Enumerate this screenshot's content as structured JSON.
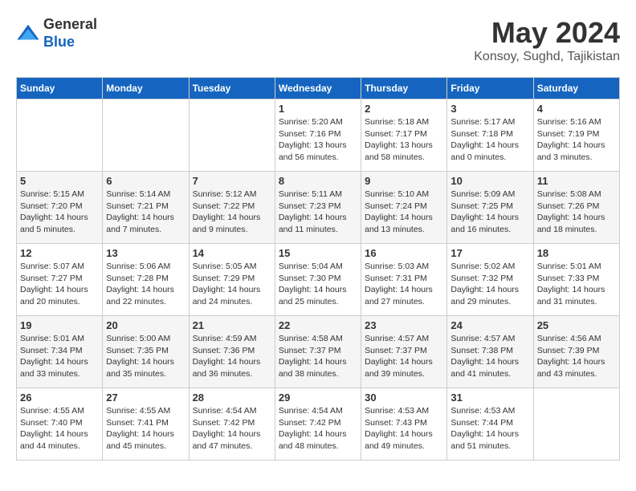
{
  "logo": {
    "line1": "General",
    "line2": "Blue"
  },
  "title": "May 2024",
  "subtitle": "Konsoy, Sughd, Tajikistan",
  "weekdays": [
    "Sunday",
    "Monday",
    "Tuesday",
    "Wednesday",
    "Thursday",
    "Friday",
    "Saturday"
  ],
  "weeks": [
    [
      {
        "day": "",
        "sunrise": "",
        "sunset": "",
        "daylight": ""
      },
      {
        "day": "",
        "sunrise": "",
        "sunset": "",
        "daylight": ""
      },
      {
        "day": "",
        "sunrise": "",
        "sunset": "",
        "daylight": ""
      },
      {
        "day": "1",
        "sunrise": "Sunrise: 5:20 AM",
        "sunset": "Sunset: 7:16 PM",
        "daylight": "Daylight: 13 hours and 56 minutes."
      },
      {
        "day": "2",
        "sunrise": "Sunrise: 5:18 AM",
        "sunset": "Sunset: 7:17 PM",
        "daylight": "Daylight: 13 hours and 58 minutes."
      },
      {
        "day": "3",
        "sunrise": "Sunrise: 5:17 AM",
        "sunset": "Sunset: 7:18 PM",
        "daylight": "Daylight: 14 hours and 0 minutes."
      },
      {
        "day": "4",
        "sunrise": "Sunrise: 5:16 AM",
        "sunset": "Sunset: 7:19 PM",
        "daylight": "Daylight: 14 hours and 3 minutes."
      }
    ],
    [
      {
        "day": "5",
        "sunrise": "Sunrise: 5:15 AM",
        "sunset": "Sunset: 7:20 PM",
        "daylight": "Daylight: 14 hours and 5 minutes."
      },
      {
        "day": "6",
        "sunrise": "Sunrise: 5:14 AM",
        "sunset": "Sunset: 7:21 PM",
        "daylight": "Daylight: 14 hours and 7 minutes."
      },
      {
        "day": "7",
        "sunrise": "Sunrise: 5:12 AM",
        "sunset": "Sunset: 7:22 PM",
        "daylight": "Daylight: 14 hours and 9 minutes."
      },
      {
        "day": "8",
        "sunrise": "Sunrise: 5:11 AM",
        "sunset": "Sunset: 7:23 PM",
        "daylight": "Daylight: 14 hours and 11 minutes."
      },
      {
        "day": "9",
        "sunrise": "Sunrise: 5:10 AM",
        "sunset": "Sunset: 7:24 PM",
        "daylight": "Daylight: 14 hours and 13 minutes."
      },
      {
        "day": "10",
        "sunrise": "Sunrise: 5:09 AM",
        "sunset": "Sunset: 7:25 PM",
        "daylight": "Daylight: 14 hours and 16 minutes."
      },
      {
        "day": "11",
        "sunrise": "Sunrise: 5:08 AM",
        "sunset": "Sunset: 7:26 PM",
        "daylight": "Daylight: 14 hours and 18 minutes."
      }
    ],
    [
      {
        "day": "12",
        "sunrise": "Sunrise: 5:07 AM",
        "sunset": "Sunset: 7:27 PM",
        "daylight": "Daylight: 14 hours and 20 minutes."
      },
      {
        "day": "13",
        "sunrise": "Sunrise: 5:06 AM",
        "sunset": "Sunset: 7:28 PM",
        "daylight": "Daylight: 14 hours and 22 minutes."
      },
      {
        "day": "14",
        "sunrise": "Sunrise: 5:05 AM",
        "sunset": "Sunset: 7:29 PM",
        "daylight": "Daylight: 14 hours and 24 minutes."
      },
      {
        "day": "15",
        "sunrise": "Sunrise: 5:04 AM",
        "sunset": "Sunset: 7:30 PM",
        "daylight": "Daylight: 14 hours and 25 minutes."
      },
      {
        "day": "16",
        "sunrise": "Sunrise: 5:03 AM",
        "sunset": "Sunset: 7:31 PM",
        "daylight": "Daylight: 14 hours and 27 minutes."
      },
      {
        "day": "17",
        "sunrise": "Sunrise: 5:02 AM",
        "sunset": "Sunset: 7:32 PM",
        "daylight": "Daylight: 14 hours and 29 minutes."
      },
      {
        "day": "18",
        "sunrise": "Sunrise: 5:01 AM",
        "sunset": "Sunset: 7:33 PM",
        "daylight": "Daylight: 14 hours and 31 minutes."
      }
    ],
    [
      {
        "day": "19",
        "sunrise": "Sunrise: 5:01 AM",
        "sunset": "Sunset: 7:34 PM",
        "daylight": "Daylight: 14 hours and 33 minutes."
      },
      {
        "day": "20",
        "sunrise": "Sunrise: 5:00 AM",
        "sunset": "Sunset: 7:35 PM",
        "daylight": "Daylight: 14 hours and 35 minutes."
      },
      {
        "day": "21",
        "sunrise": "Sunrise: 4:59 AM",
        "sunset": "Sunset: 7:36 PM",
        "daylight": "Daylight: 14 hours and 36 minutes."
      },
      {
        "day": "22",
        "sunrise": "Sunrise: 4:58 AM",
        "sunset": "Sunset: 7:37 PM",
        "daylight": "Daylight: 14 hours and 38 minutes."
      },
      {
        "day": "23",
        "sunrise": "Sunrise: 4:57 AM",
        "sunset": "Sunset: 7:37 PM",
        "daylight": "Daylight: 14 hours and 39 minutes."
      },
      {
        "day": "24",
        "sunrise": "Sunrise: 4:57 AM",
        "sunset": "Sunset: 7:38 PM",
        "daylight": "Daylight: 14 hours and 41 minutes."
      },
      {
        "day": "25",
        "sunrise": "Sunrise: 4:56 AM",
        "sunset": "Sunset: 7:39 PM",
        "daylight": "Daylight: 14 hours and 43 minutes."
      }
    ],
    [
      {
        "day": "26",
        "sunrise": "Sunrise: 4:55 AM",
        "sunset": "Sunset: 7:40 PM",
        "daylight": "Daylight: 14 hours and 44 minutes."
      },
      {
        "day": "27",
        "sunrise": "Sunrise: 4:55 AM",
        "sunset": "Sunset: 7:41 PM",
        "daylight": "Daylight: 14 hours and 45 minutes."
      },
      {
        "day": "28",
        "sunrise": "Sunrise: 4:54 AM",
        "sunset": "Sunset: 7:42 PM",
        "daylight": "Daylight: 14 hours and 47 minutes."
      },
      {
        "day": "29",
        "sunrise": "Sunrise: 4:54 AM",
        "sunset": "Sunset: 7:42 PM",
        "daylight": "Daylight: 14 hours and 48 minutes."
      },
      {
        "day": "30",
        "sunrise": "Sunrise: 4:53 AM",
        "sunset": "Sunset: 7:43 PM",
        "daylight": "Daylight: 14 hours and 49 minutes."
      },
      {
        "day": "31",
        "sunrise": "Sunrise: 4:53 AM",
        "sunset": "Sunset: 7:44 PM",
        "daylight": "Daylight: 14 hours and 51 minutes."
      },
      {
        "day": "",
        "sunrise": "",
        "sunset": "",
        "daylight": ""
      }
    ]
  ]
}
